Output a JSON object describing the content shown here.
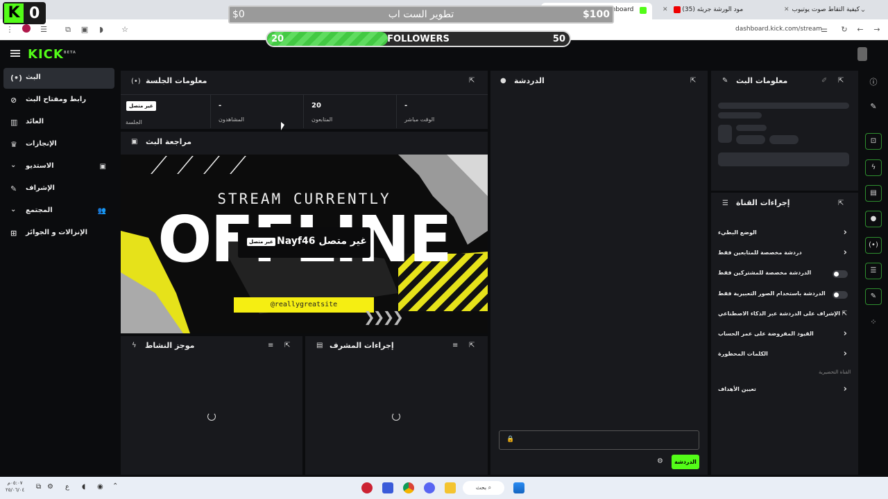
{
  "browser": {
    "tabs": [
      {
        "label": "كيفية التقاط صوت يوتيوب",
        "active": false
      },
      {
        "label": "(35) مود الورشة جريئه",
        "active": false
      },
      {
        "label": "Stream - Kick Dashboard",
        "active": true
      }
    ],
    "url": "dashboard.kick.com/stream"
  },
  "overlay": {
    "badge_letter": "K",
    "badge_count": "0",
    "goal_left": "$0",
    "goal_title": "تطوير الست اب",
    "goal_right": "$100",
    "followers_current": "20",
    "followers_label": "FOLLOWERS",
    "followers_goal": "50",
    "followers_progress": 0.4
  },
  "app": {
    "logo": "KICK",
    "logo_sup": "BETA"
  },
  "nav": {
    "items": [
      {
        "label": "البث"
      },
      {
        "label": "رابط ومفتاح البث"
      },
      {
        "label": "العائد"
      },
      {
        "label": "الإنجازات"
      },
      {
        "label": "الاستديو"
      },
      {
        "label": "الإشراف"
      },
      {
        "label": "المجتمع"
      },
      {
        "label": "الإنزالات و الجوائز"
      }
    ]
  },
  "session": {
    "title": "معلومات الجلسة",
    "stats": [
      {
        "value": "غير متصل",
        "label": "الجلسة"
      },
      {
        "value": "-",
        "label": "المشاهدون"
      },
      {
        "value": "20",
        "label": "المتابعون"
      },
      {
        "value": "-",
        "label": "الوقت مباشر"
      }
    ]
  },
  "preview": {
    "title": "مراجعة البث",
    "line1": "STREAM CURRENTLY",
    "line2": "OFFLINE",
    "site": "@reallygreatsite",
    "status_badge": "غير متصل",
    "channel_status": "Nayf46 غير متصل"
  },
  "activity": {
    "title": "موجز النشاط"
  },
  "mod_actions": {
    "title": "إجراءات المشرف"
  },
  "chat": {
    "title": "الدردشة",
    "send_label": "الدردشة"
  },
  "stream_info": {
    "title": "معلومات البث"
  },
  "channel_actions": {
    "title": "إجراءات القناة",
    "items": [
      {
        "label": "الوضع البطيء",
        "control": "chevron"
      },
      {
        "label": "دردشة مخصصة للمتابعين فقط",
        "control": "chevron"
      },
      {
        "label": "الدردشة مخصصة للمشتركين فقط",
        "control": "toggle"
      },
      {
        "label": "الدردشة باستخدام الصور التعبيرية فقط",
        "control": "toggle"
      },
      {
        "label": "الإشراف على الدردشة عبر الذكاء الاصطناعي",
        "control": "external"
      },
      {
        "label": "القيود المفروضة على عمر الحساب",
        "control": "chevron"
      },
      {
        "label": "الكلمات المحظورة",
        "control": "chevron"
      }
    ],
    "section_label": "القناة التحضيرية",
    "goals_label": "تعيين الأهداف"
  },
  "taskbar": {
    "search": "بحث",
    "time": "٠٥:٠٧م",
    "date": "٢٥/٠٦/٠٤"
  }
}
